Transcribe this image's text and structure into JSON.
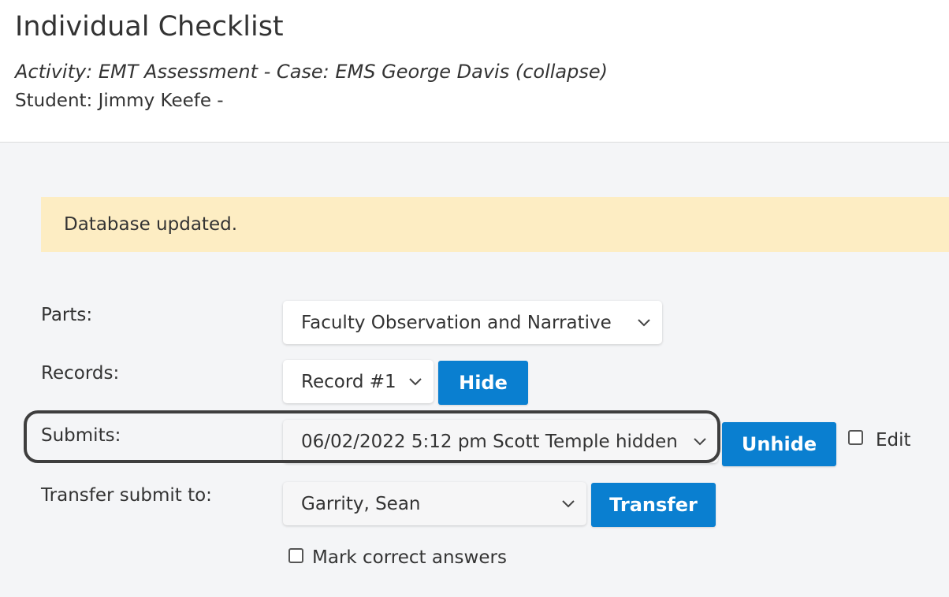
{
  "header": {
    "title": "Individual Checklist",
    "activity": "Activity: EMT Assessment - Case: EMS George Davis (collapse)",
    "student": "Student: Jimmy Keefe -"
  },
  "alert": {
    "message": "Database updated."
  },
  "form": {
    "parts": {
      "label": "Parts:",
      "selected": "Faculty Observation and Narrative"
    },
    "records": {
      "label": "Records:",
      "selected": "Record #1",
      "button": "Hide"
    },
    "submits": {
      "label": "Submits:",
      "selected": "06/02/2022 5:12 pm Scott Temple hidden",
      "button": "Unhide",
      "edit_label": "Edit"
    },
    "transfer": {
      "label": "Transfer submit to:",
      "selected": "Garrity, Sean",
      "button": "Transfer"
    },
    "mark_correct": {
      "label": "Mark correct answers"
    }
  },
  "colors": {
    "primary_button": "#0a7fd0",
    "alert_bg": "#fdedc3",
    "page_bg": "#f4f5f7"
  }
}
